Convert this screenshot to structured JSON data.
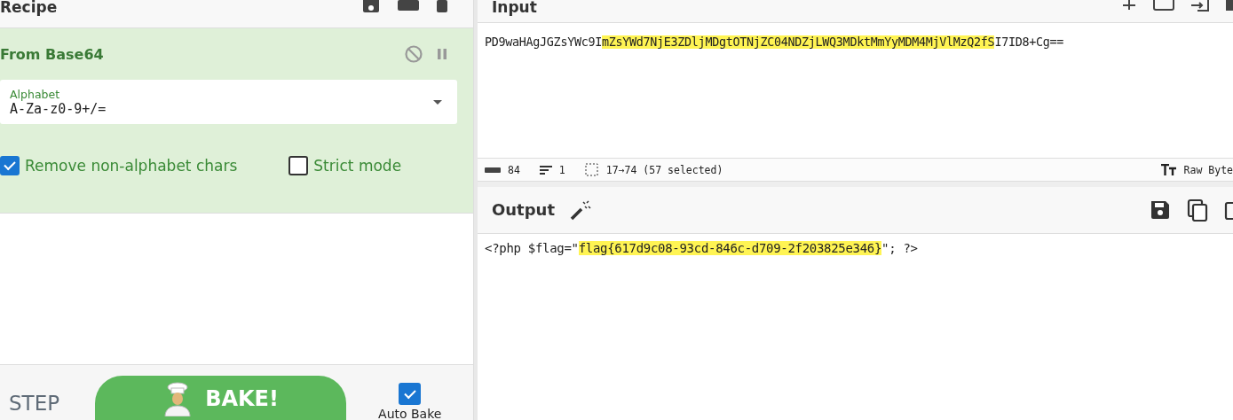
{
  "recipe": {
    "title": "Recipe",
    "operation": {
      "name": "From Base64",
      "disabled": false,
      "paused": false,
      "alphabet": {
        "label": "Alphabet",
        "value": "A-Za-z0-9+/="
      },
      "options": [
        {
          "label": "Remove non-alphabet chars",
          "checked": true
        },
        {
          "label": "Strict mode",
          "checked": false
        }
      ]
    }
  },
  "controls": {
    "step": "STEP",
    "bake": "BAKE!",
    "auto_bake": {
      "label": "Auto Bake",
      "checked": true
    }
  },
  "input": {
    "title": "Input",
    "text_before": "PD9waHAgJGZsYWc9I",
    "text_selected": "mZsYWd7NjE3ZDljMDgtOTNjZC04NDZjLWQ3MDktMmYyMDM4MjVlMzQ2fS",
    "text_after": "I7ID8+Cg=="
  },
  "status_bar": {
    "chars": "84",
    "lines": "1",
    "selection": "17→74 (57 selected)",
    "mode": "Raw Byte"
  },
  "output": {
    "title": "Output",
    "text_before": "<?php $flag=\"",
    "text_selected": "flag{617d9c08-93cd-846c-d709-2f203825e346}",
    "text_after": "\"; ?>"
  }
}
